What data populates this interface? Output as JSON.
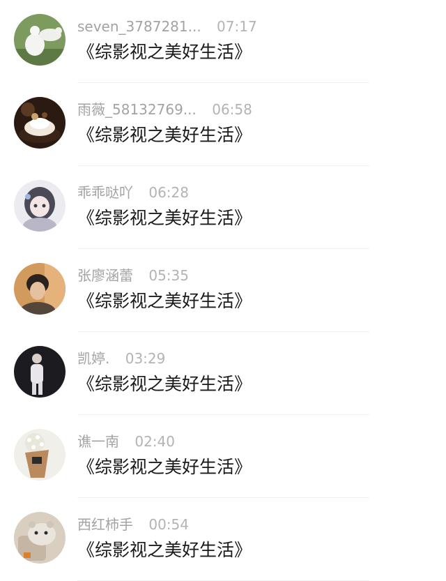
{
  "comments": [
    {
      "name": "seven_3787281...",
      "time": "07:17",
      "text": "《综影视之美好生活》",
      "avatar": "white-dove-avatar"
    },
    {
      "name": "雨薇_58132769...",
      "time": "06:58",
      "text": "《综影视之美好生活》",
      "avatar": "cake-avatar"
    },
    {
      "name": "乖乖哒吖",
      "time": "06:28",
      "text": "《综影视之美好生活》",
      "avatar": "anime-girl-avatar"
    },
    {
      "name": "张廖涵蕾",
      "time": "05:35",
      "text": "《综影视之美好生活》",
      "avatar": "man-portrait-avatar"
    },
    {
      "name": "凯婷.",
      "time": "03:29",
      "text": "《综影视之美好生活》",
      "avatar": "standing-man-avatar"
    },
    {
      "name": "谯一南",
      "time": "02:40",
      "text": "《综影视之美好生活》",
      "avatar": "flower-bouquet-avatar"
    },
    {
      "name": "西红柿手",
      "time": "00:54",
      "text": "《综影视之美好生活》",
      "avatar": "hamster-avatar"
    }
  ]
}
